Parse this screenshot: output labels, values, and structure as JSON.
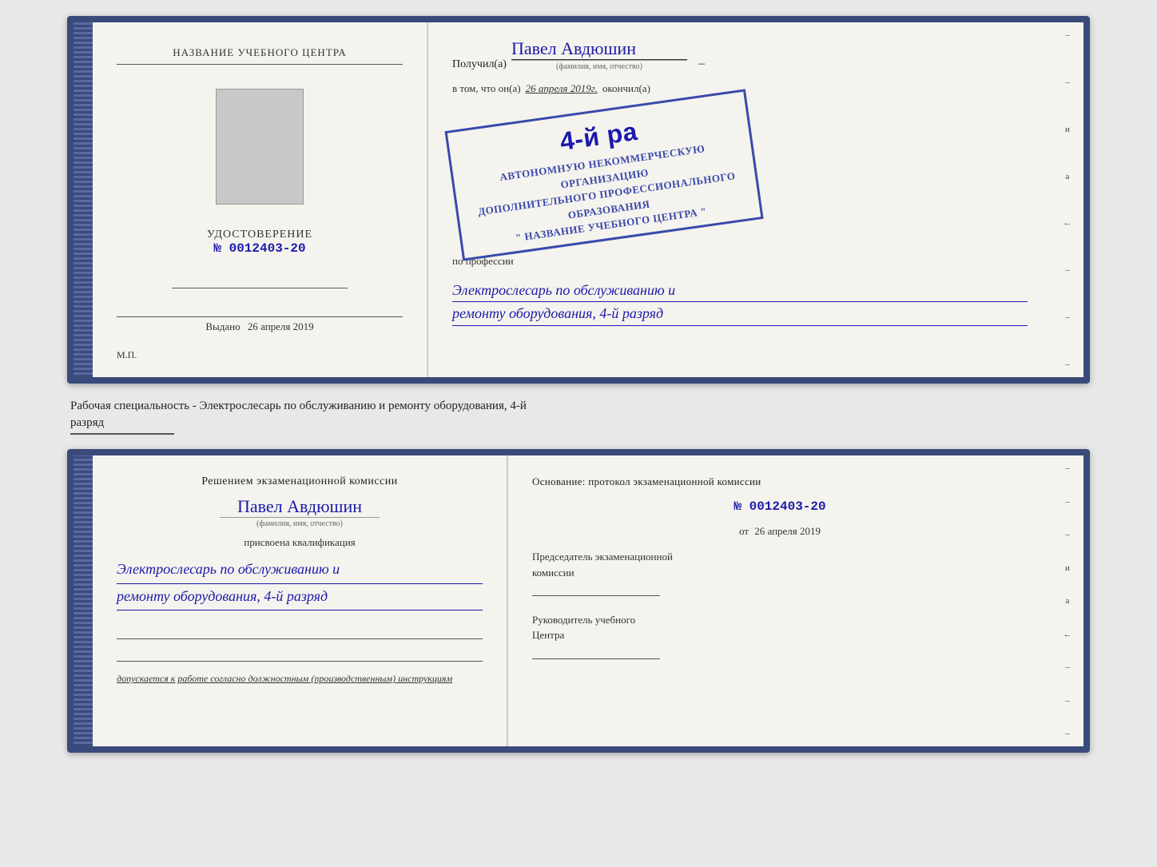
{
  "topDoc": {
    "left": {
      "title": "НАЗВАНИЕ УЧЕБНОГО ЦЕНТРА",
      "udostoverenie": "УДОСТОВЕРЕНИЕ",
      "number": "№ 0012403-20",
      "vydano_label": "Выдано",
      "vydano_date": "26 апреля 2019",
      "mp": "М.П."
    },
    "right": {
      "poluchil": "Получил(а)",
      "name": "Павел Авдюшин",
      "fio_sub": "(фамилия, имя, отчество)",
      "vtom": "в том, что он(а)",
      "date": "26 апреля 2019г.",
      "okonchil": "окончил(а)",
      "rank_big": "4-й ра",
      "stamp_line1": "АВТОНОМНУЮ НЕКОММЕРЧЕСКУЮ ОРГАНИЗАЦИЮ",
      "stamp_line2": "ДОПОЛНИТЕЛЬНОГО ПРОФЕССИОНАЛЬНОГО ОБРАЗОВАНИЯ",
      "stamp_line3": "\" НАЗВАНИЕ УЧЕБНОГО ЦЕНТРА \"",
      "po_professii": "по профессии",
      "profession_line1": "Электрослесарь по обслуживанию и",
      "profession_line2": "ремонту оборудования, 4-й разряд"
    },
    "edge": {
      "chars": [
        "–",
        "–",
        "и",
        "а",
        "←",
        "–",
        "–",
        "–"
      ]
    }
  },
  "middleText": {
    "line1": "Рабочая специальность - Электрослесарь по обслуживанию и ремонту оборудования, 4-й",
    "line2": "разряд"
  },
  "bottomDoc": {
    "left": {
      "resheniyem": "Решением экзаменационной комиссии",
      "name": "Павел Авдюшин",
      "fio_sub": "(фамилия, имя, отчество)",
      "prisvoyena": "присвоена квалификация",
      "qual_line1": "Электрослесарь по обслуживанию и",
      "qual_line2": "ремонту оборудования, 4-й разряд",
      "dopuskaetsya_prefix": "допускается к",
      "dopuskaetsya_text": "работе согласно должностным (производственным) инструкциям"
    },
    "right": {
      "osnovanie": "Основание: протокол экзаменационной комиссии",
      "number": "№ 0012403-20",
      "ot_prefix": "от",
      "ot_date": "26 апреля 2019",
      "predsedatel_line1": "Председатель экзаменационной",
      "predsedatel_line2": "комиссии",
      "rukovoditel_line1": "Руководитель учебного",
      "rukovoditel_line2": "Центра"
    },
    "edge": {
      "chars": [
        "–",
        "–",
        "–",
        "и",
        "а",
        "←",
        "–",
        "–",
        "–"
      ]
    }
  }
}
